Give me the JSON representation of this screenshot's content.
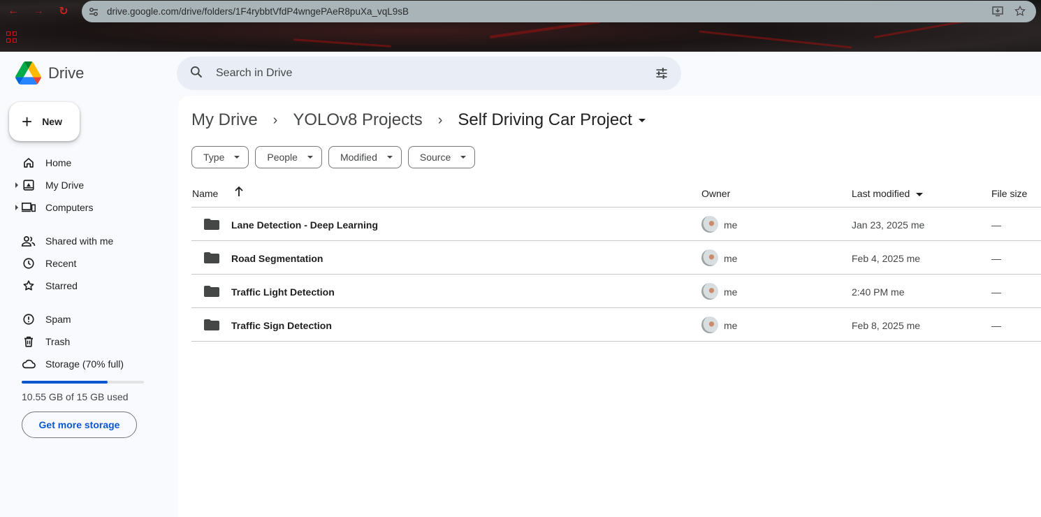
{
  "browser": {
    "url": "drive.google.com/drive/folders/1F4rybbtVfdP4wngePAeR8puXa_vqL9sB"
  },
  "app": {
    "name": "Drive",
    "search_placeholder": "Search in Drive"
  },
  "sidebar": {
    "new_label": "New",
    "items": [
      {
        "label": "Home",
        "icon": "home-icon"
      },
      {
        "label": "My Drive",
        "icon": "my-drive-icon"
      },
      {
        "label": "Computers",
        "icon": "computers-icon"
      },
      {
        "label": "Shared with me",
        "icon": "shared-icon"
      },
      {
        "label": "Recent",
        "icon": "clock-icon"
      },
      {
        "label": "Starred",
        "icon": "star-icon"
      },
      {
        "label": "Spam",
        "icon": "spam-icon"
      },
      {
        "label": "Trash",
        "icon": "trash-icon"
      },
      {
        "label": "Storage (70% full)",
        "icon": "cloud-icon"
      }
    ],
    "storage_used_fraction": 0.7,
    "storage_text": "10.55 GB of 15 GB used",
    "get_storage_label": "Get more storage"
  },
  "breadcrumb": [
    "My Drive",
    "YOLOv8 Projects",
    "Self Driving Car Project"
  ],
  "filters": [
    "Type",
    "People",
    "Modified",
    "Source"
  ],
  "table": {
    "columns": {
      "name": "Name",
      "owner": "Owner",
      "modified": "Last modified",
      "size": "File size"
    },
    "rows": [
      {
        "name": "Lane Detection - Deep Learning",
        "owner": "me",
        "modified": "Jan 23, 2025 me",
        "size": "—"
      },
      {
        "name": "Road Segmentation",
        "owner": "me",
        "modified": "Feb 4, 2025 me",
        "size": "—"
      },
      {
        "name": "Traffic Light Detection",
        "owner": "me",
        "modified": "2:40 PM me",
        "size": "—"
      },
      {
        "name": "Traffic Sign Detection",
        "owner": "me",
        "modified": "Feb 8, 2025 me",
        "size": "—"
      }
    ]
  },
  "colors": {
    "accent": "#0b57d0",
    "chrome_red": "#d32020"
  }
}
